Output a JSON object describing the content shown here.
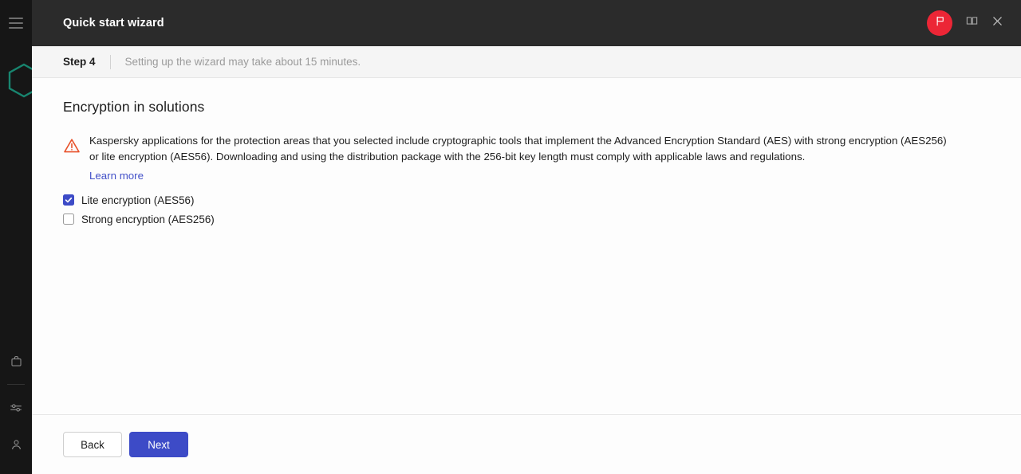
{
  "sidebar": {
    "menu_icon": "hamburger-menu-icon",
    "logo_icon": "kaspersky-hexagon-logo",
    "items": [
      {
        "icon": "briefcase-icon",
        "name": "sidebar-item-marketplace"
      },
      {
        "icon": "sliders-icon",
        "name": "sidebar-item-settings"
      },
      {
        "icon": "user-icon",
        "name": "sidebar-item-account"
      }
    ]
  },
  "header": {
    "title": "Quick start wizard",
    "flag_icon": "flag-icon",
    "help_icon": "book-icon",
    "close_icon": "close-icon",
    "flag_color": "#ec2636"
  },
  "step_bar": {
    "step_label": "Step 4",
    "note": "Setting up the wizard may take about 15 minutes."
  },
  "content": {
    "title": "Encryption in solutions",
    "warning_icon": "warning-triangle-icon",
    "warning_color": "#e8522b",
    "warning_text": "Kaspersky applications for the protection areas that you selected include cryptographic tools that implement the Advanced Encryption Standard (AES) with strong encryption (AES256) or lite encryption (AES56). Downloading and using the distribution package with the 256-bit key length must comply with applicable laws and regulations.",
    "learn_more_label": "Learn more",
    "link_color": "#4250c8",
    "options": [
      {
        "label": "Lite encryption (AES56)",
        "checked": true
      },
      {
        "label": "Strong encryption (AES256)",
        "checked": false
      }
    ]
  },
  "footer": {
    "back_label": "Back",
    "next_label": "Next",
    "primary_color": "#3d4bc7"
  }
}
